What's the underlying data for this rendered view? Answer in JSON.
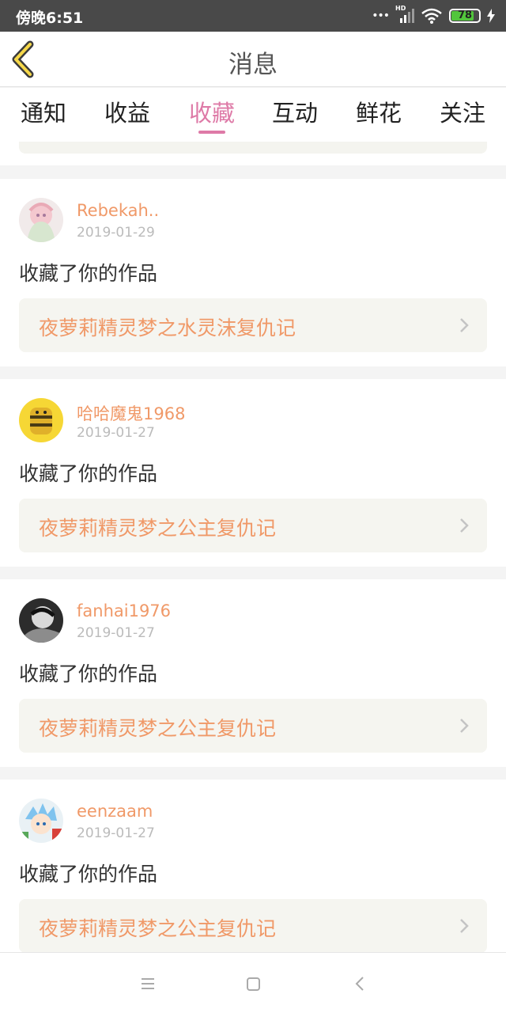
{
  "status_bar": {
    "time": "傍晚6:51",
    "signal_badge": "HD",
    "battery": "78",
    "icons": [
      "more-dots-icon",
      "signal-icon",
      "wifi-icon",
      "battery-icon",
      "charging-icon"
    ]
  },
  "header": {
    "title": "消息",
    "back_icon": "chevron-left-icon",
    "accent_color": "#de7aa7",
    "name_color": "#f09968"
  },
  "tabs": [
    {
      "label": "通知",
      "active": false
    },
    {
      "label": "收益",
      "active": false
    },
    {
      "label": "收藏",
      "active": true
    },
    {
      "label": "互动",
      "active": false
    },
    {
      "label": "鲜花",
      "active": false
    },
    {
      "label": "关注",
      "active": false
    }
  ],
  "items": [
    {
      "user": "Rebekah..",
      "date": "2019-01-29",
      "action": "收藏了你的作品",
      "work": "夜萝莉精灵梦之水灵沫复仇记"
    },
    {
      "user": "哈哈魔鬼1968",
      "date": "2019-01-27",
      "action": "收藏了你的作品",
      "work": "夜萝莉精灵梦之公主复仇记"
    },
    {
      "user": "fanhai1976",
      "date": "2019-01-27",
      "action": "收藏了你的作品",
      "work": "夜萝莉精灵梦之公主复仇记"
    },
    {
      "user": "eenzaam",
      "date": "2019-01-27",
      "action": "收藏了你的作品",
      "work": "夜萝莉精灵梦之公主复仇记"
    }
  ],
  "nav_bar": {
    "icons": [
      "menu-icon",
      "home-square-icon",
      "back-triangle-icon"
    ]
  }
}
